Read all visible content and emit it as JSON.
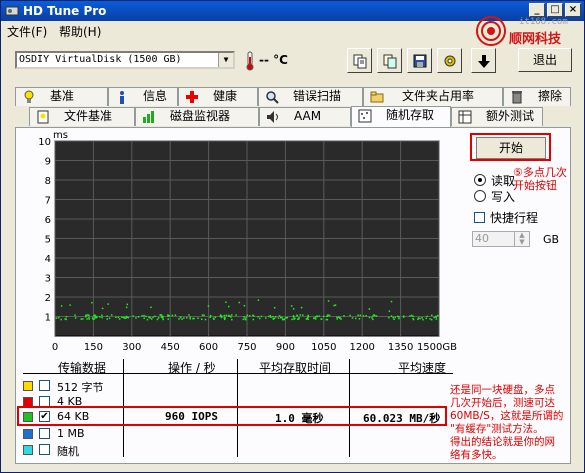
{
  "window": {
    "title": "HD Tune Pro"
  },
  "watermark": {
    "site": "it168.com",
    "name": "顺网科技"
  },
  "menu": [
    "文件(F)",
    "帮助(H)"
  ],
  "toolbar": {
    "drive": "OSDIY VirtualDisk (1500 GB)",
    "temperature": "-- °C",
    "exit_label": "退出",
    "buttons": [
      "copy-text-icon",
      "copy-screen-icon",
      "save-icon",
      "options-icon",
      "down-arrow-icon"
    ]
  },
  "tabs_top": [
    "基准",
    "信息",
    "健康",
    "错误扫描",
    "文件夹占用率",
    "擦除"
  ],
  "tabs_bottom": [
    "文件基准",
    "磁盘监视器",
    "AAM",
    "随机存取",
    "额外测试"
  ],
  "active_tab": "随机存取",
  "controls": {
    "start_label": "开始",
    "read_label": "读取",
    "write_label": "写入",
    "selected_mode": "读取",
    "quick_label": "快捷行程",
    "quick_checked": false,
    "gb_value": "40",
    "gb_unit": "GB"
  },
  "annotations": {
    "start_note": "⑤多点几次\n开始按钮",
    "result_note": "还是同一块硬盘，多点\n几次开始后，测速可达\n60MB/S，这就是所谓的\n\"有缓存\"测试方法。\n得出的结论就是你的网\n络有多快。"
  },
  "colors": {
    "plot_bg": "#2a2a2a",
    "grid": "#5a5a5a",
    "points": "#22ee22",
    "annot_red": "#e00000"
  },
  "chart_data": {
    "type": "scatter",
    "y_unit": "ms",
    "x_tick_labels": [
      "0",
      "150",
      "300",
      "450",
      "600",
      "750",
      "900",
      "1050",
      "1200",
      "1350",
      "1500GB"
    ],
    "xlim": [
      0,
      1500
    ],
    "ylim": [
      0,
      10
    ],
    "y_ticks": [
      1,
      2,
      3,
      4,
      5,
      6,
      7,
      8,
      9,
      10
    ],
    "grid": true,
    "series": [
      {
        "name": "64 KB",
        "color": "#22ee22",
        "approx_access_time_ms": 1.0,
        "spread_ms": 0.25,
        "x_range_gb": [
          0,
          1500
        ]
      }
    ]
  },
  "results": {
    "headers": [
      "传输数据",
      "操作 / 秒",
      "平均存取时间",
      "平均速度"
    ],
    "rows": [
      {
        "color": "#ffd800",
        "label": "512 字节",
        "checked": false,
        "ops": "",
        "access": "",
        "speed": ""
      },
      {
        "color": "#e00000",
        "label": "4 KB",
        "checked": false,
        "ops": "",
        "access": "",
        "speed": ""
      },
      {
        "color": "#22c022",
        "label": "64 KB",
        "checked": true,
        "ops": "960 IOPS",
        "access": "1.0 毫秒",
        "speed": "60.023 MB/秒"
      },
      {
        "color": "#1f6fd0",
        "label": "1 MB",
        "checked": false,
        "ops": "",
        "access": "",
        "speed": ""
      },
      {
        "color": "#30d8e0",
        "label": "随机",
        "checked": false,
        "ops": "",
        "access": "",
        "speed": ""
      }
    ]
  }
}
